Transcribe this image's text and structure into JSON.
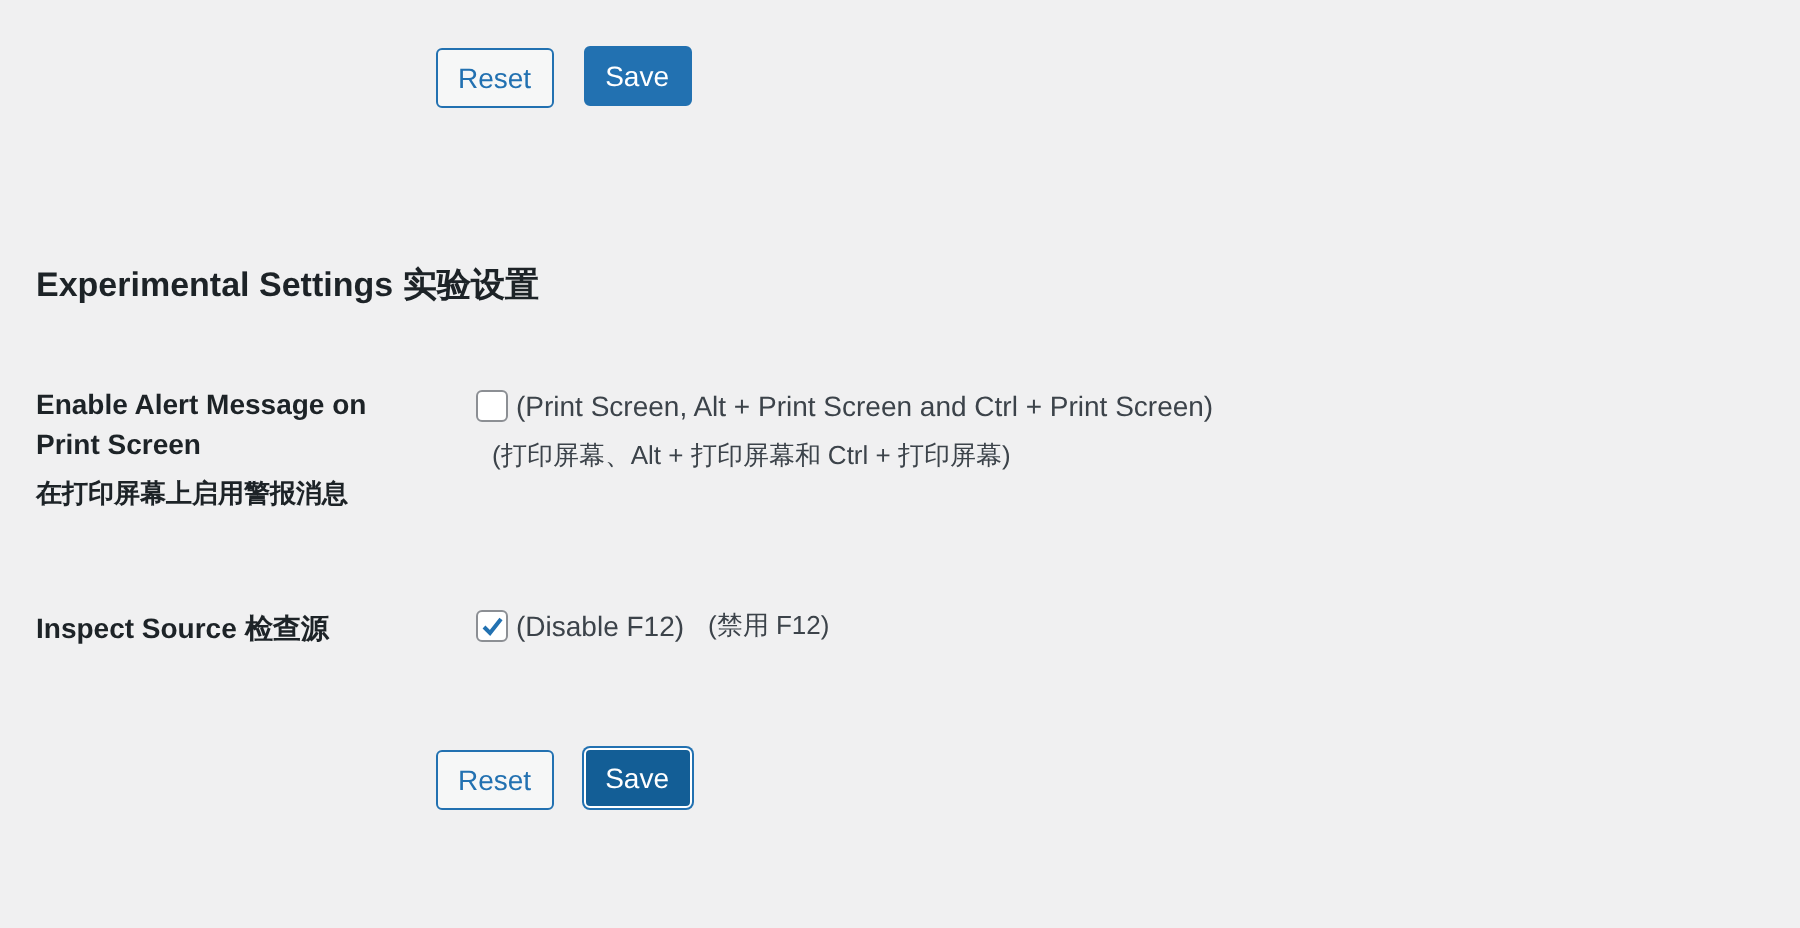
{
  "top_actions": [
    {
      "label": "Reset",
      "kind": "secondary",
      "focused": false
    },
    {
      "label": "Save",
      "kind": "primary",
      "focused": false
    }
  ],
  "section": {
    "heading": "Experimental Settings 实验设置"
  },
  "settings": [
    {
      "kind": "stacked",
      "label": "Enable Alert Message on Print Screen",
      "label_note": "在打印屏幕上启用警报消息",
      "checked": false,
      "description": "(Print Screen, Alt + Print Screen and Ctrl + Print Screen)",
      "note": "(打印屏幕、Alt + 打印屏幕和 Ctrl + 打印屏幕)"
    },
    {
      "kind": "inline",
      "label": "Inspect Source 检查源",
      "checked": true,
      "description": "(Disable F12)",
      "note": "(禁用 F12)"
    }
  ],
  "bottom_actions": [
    {
      "label": "Reset",
      "kind": "secondary",
      "focused": false
    },
    {
      "label": "Save",
      "kind": "primary",
      "focused": true
    }
  ]
}
